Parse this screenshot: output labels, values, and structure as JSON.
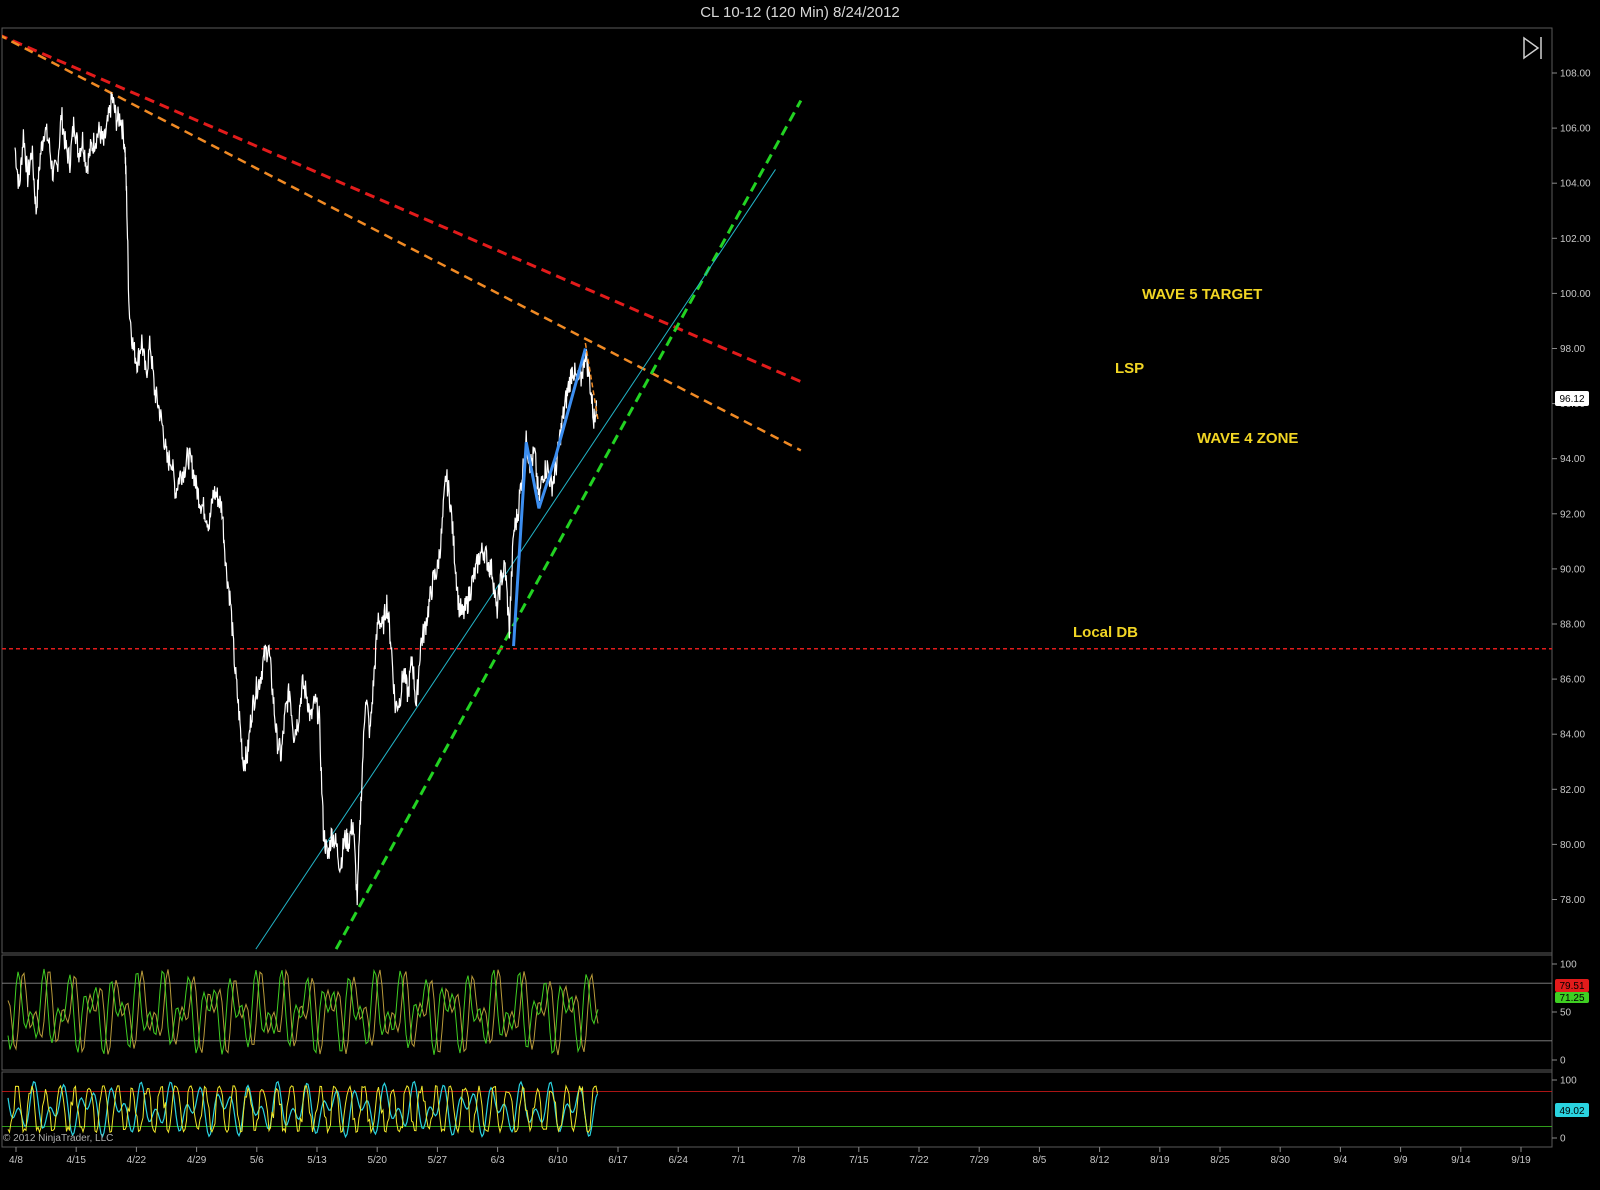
{
  "window": {
    "title": "CL 10-12 (120 Min)  8/24/2012",
    "copyright": "© 2012 NinjaTrader, LLC"
  },
  "colors": {
    "background": "#000000",
    "price": "#ffffff",
    "wave5_line": "#e21b1b",
    "resistance_line": "#f08a24",
    "support_line": "#22d322",
    "channel_line": "#22b5c8",
    "local_db": "#e21b1b",
    "wave_path": "#3c8ef0",
    "annotation": "#f2d624",
    "osc_green": "#3fcf22",
    "osc_brown": "#b89a3a",
    "osc2_yellow": "#f0e62a",
    "osc2_cyan": "#2ad3e0"
  },
  "chart_data": {
    "type": "line",
    "title": "CL 10-12 (120 Min)  8/24/2012",
    "x_ticks": [
      "4/8",
      "4/15",
      "4/22",
      "4/29",
      "5/6",
      "5/13",
      "5/20",
      "5/27",
      "6/3",
      "6/10",
      "6/17",
      "6/24",
      "7/1",
      "7/8",
      "7/15",
      "7/22",
      "7/29",
      "8/5",
      "8/12",
      "8/19",
      "8/25",
      "8/30",
      "9/4",
      "9/9",
      "9/14",
      "9/19"
    ],
    "y_ticks": [
      "108.00",
      "106.00",
      "104.00",
      "102.00",
      "100.00",
      "98.00",
      "96.00",
      "94.00",
      "92.00",
      "90.00",
      "88.00",
      "86.00",
      "84.00",
      "82.00",
      "80.00",
      "78.00"
    ],
    "ylim": [
      76.2,
      109.4
    ],
    "last_price": "96.12",
    "series": [
      {
        "values": [
          [
            0,
            105.3
          ],
          [
            0.5,
            103.8
          ],
          [
            1,
            105.8
          ],
          [
            1.5,
            104.2
          ],
          [
            2,
            105.2
          ],
          [
            2.5,
            103.0
          ],
          [
            3,
            105.0
          ],
          [
            3.5,
            106.0
          ],
          [
            4,
            105.5
          ],
          [
            4.5,
            104.3
          ],
          [
            5,
            104.6
          ],
          [
            5.5,
            106.5
          ],
          [
            6,
            105.3
          ],
          [
            6.5,
            104.8
          ],
          [
            7,
            106.3
          ],
          [
            7.5,
            105.1
          ],
          [
            8,
            105.6
          ],
          [
            8.5,
            104.6
          ],
          [
            9,
            105.3
          ],
          [
            9.5,
            105.6
          ],
          [
            10,
            105.9
          ],
          [
            10.5,
            105.4
          ],
          [
            11,
            106.2
          ],
          [
            11.5,
            107.1
          ],
          [
            12,
            106.3
          ],
          [
            12.5,
            106.4
          ],
          [
            13,
            105.4
          ],
          [
            13.2,
            103.6
          ],
          [
            13.5,
            99.5
          ],
          [
            14,
            98.0
          ],
          [
            14.5,
            97.5
          ],
          [
            15,
            98.3
          ],
          [
            15.5,
            97.0
          ],
          [
            16,
            98.2
          ],
          [
            16.5,
            96.5
          ],
          [
            17,
            95.9
          ],
          [
            17.5,
            95.1
          ],
          [
            18,
            93.9
          ],
          [
            18.5,
            94.0
          ],
          [
            19,
            92.8
          ],
          [
            19.5,
            93.4
          ],
          [
            20,
            93.6
          ],
          [
            20.5,
            94.1
          ],
          [
            21,
            93.7
          ],
          [
            21.5,
            92.9
          ],
          [
            22,
            92.4
          ],
          [
            22.5,
            92.1
          ],
          [
            23,
            91.6
          ],
          [
            23.5,
            92.8
          ],
          [
            24,
            92.6
          ],
          [
            24.5,
            92.2
          ],
          [
            25,
            90.0
          ],
          [
            25.5,
            88.8
          ],
          [
            26,
            86.5
          ],
          [
            26.5,
            84.8
          ],
          [
            27,
            83.0
          ],
          [
            27.5,
            83.2
          ],
          [
            28,
            84.8
          ],
          [
            28.5,
            85.6
          ],
          [
            29,
            86.0
          ],
          [
            29.5,
            86.8
          ],
          [
            30,
            87.2
          ],
          [
            30.5,
            85.5
          ],
          [
            31,
            83.8
          ],
          [
            31.5,
            83.2
          ],
          [
            32,
            84.8
          ],
          [
            32.5,
            85.6
          ],
          [
            33,
            84.0
          ],
          [
            33.5,
            84.5
          ],
          [
            34,
            85.8
          ],
          [
            34.5,
            85.5
          ],
          [
            35,
            84.5
          ],
          [
            35.5,
            85.2
          ],
          [
            36,
            84.6
          ],
          [
            36.5,
            80.5
          ],
          [
            37,
            79.5
          ],
          [
            37.5,
            80.4
          ],
          [
            38,
            80.0
          ],
          [
            38.5,
            79.2
          ],
          [
            39,
            80.2
          ],
          [
            39.5,
            80.1
          ],
          [
            40,
            80.8
          ],
          [
            40.5,
            78.0
          ],
          [
            41,
            82.0
          ],
          [
            41.5,
            85.5
          ],
          [
            42,
            84.0
          ],
          [
            42.5,
            86.2
          ],
          [
            43,
            88.3
          ],
          [
            43.5,
            87.8
          ],
          [
            44,
            88.8
          ],
          [
            44.5,
            87.3
          ],
          [
            45,
            85.0
          ],
          [
            45.5,
            85.2
          ],
          [
            46,
            86.3
          ],
          [
            46.5,
            85.4
          ],
          [
            47,
            86.8
          ],
          [
            47.5,
            85.0
          ],
          [
            48,
            87.3
          ],
          [
            48.5,
            87.8
          ],
          [
            49,
            88.7
          ],
          [
            49.5,
            89.6
          ],
          [
            50,
            90.0
          ],
          [
            50.5,
            91.3
          ],
          [
            51,
            93.4
          ],
          [
            51.5,
            92.5
          ],
          [
            52,
            90.6
          ],
          [
            52.5,
            88.7
          ],
          [
            53,
            88.3
          ],
          [
            53.5,
            88.7
          ],
          [
            54,
            89.4
          ],
          [
            54.5,
            89.9
          ],
          [
            55,
            90.5
          ],
          [
            55.5,
            90.7
          ],
          [
            56,
            90.2
          ],
          [
            56.5,
            89.9
          ],
          [
            57,
            88.4
          ],
          [
            57.5,
            89.6
          ],
          [
            58,
            90.1
          ],
          [
            58.5,
            87.8
          ],
          [
            59,
            91.3
          ],
          [
            59.5,
            92.0
          ],
          [
            60,
            93.4
          ],
          [
            60.5,
            94.6
          ],
          [
            61,
            93.8
          ],
          [
            61.5,
            94.2
          ],
          [
            62,
            92.5
          ],
          [
            62.5,
            93.5
          ],
          [
            63,
            93.7
          ],
          [
            63.5,
            93.0
          ],
          [
            64,
            93.6
          ],
          [
            64.5,
            94.8
          ],
          [
            65,
            95.8
          ],
          [
            65.5,
            96.6
          ],
          [
            66,
            97.3
          ],
          [
            66.5,
            96.8
          ],
          [
            67,
            96.9
          ],
          [
            67.5,
            97.9
          ],
          [
            68,
            96.9
          ],
          [
            68.5,
            95.4
          ],
          [
            68.8,
            96.12
          ]
        ]
      }
    ],
    "overlay_lines": [
      {
        "label": "WAVE 5 TARGET",
        "points": [
          [
            -2,
            109.4
          ],
          [
            93,
            96.8
          ]
        ]
      },
      {
        "points": [
          [
            -2,
            109.4
          ],
          [
            93,
            94.3
          ]
        ]
      },
      {
        "points": [
          [
            38,
            76.2
          ],
          [
            93,
            107.0
          ]
        ]
      },
      {
        "points": [
          [
            28.5,
            76.2
          ],
          [
            90,
            104.5
          ]
        ]
      },
      {
        "label": "Local DB",
        "y": 87.1
      }
    ],
    "wave_path": [
      [
        59.0,
        87.2
      ],
      [
        60.5,
        94.6
      ],
      [
        62.0,
        92.2
      ],
      [
        64.0,
        94.1
      ],
      [
        67.5,
        98.0
      ]
    ],
    "wave4_segment": [
      [
        67.5,
        98.2
      ],
      [
        69.0,
        95.4
      ]
    ],
    "annotations": [
      "WAVE 5 TARGET",
      "LSP",
      "WAVE 4 ZONE",
      "Local DB"
    ],
    "oscillator_1": {
      "y_ticks": [
        "100",
        "50",
        "0"
      ],
      "levels": [
        80,
        20
      ],
      "badges": [
        "79.51",
        "71.25"
      ]
    },
    "oscillator_2": {
      "y_ticks": [
        "100",
        "0"
      ],
      "levels": [
        80,
        20
      ],
      "badges": [
        "49.02"
      ]
    }
  }
}
